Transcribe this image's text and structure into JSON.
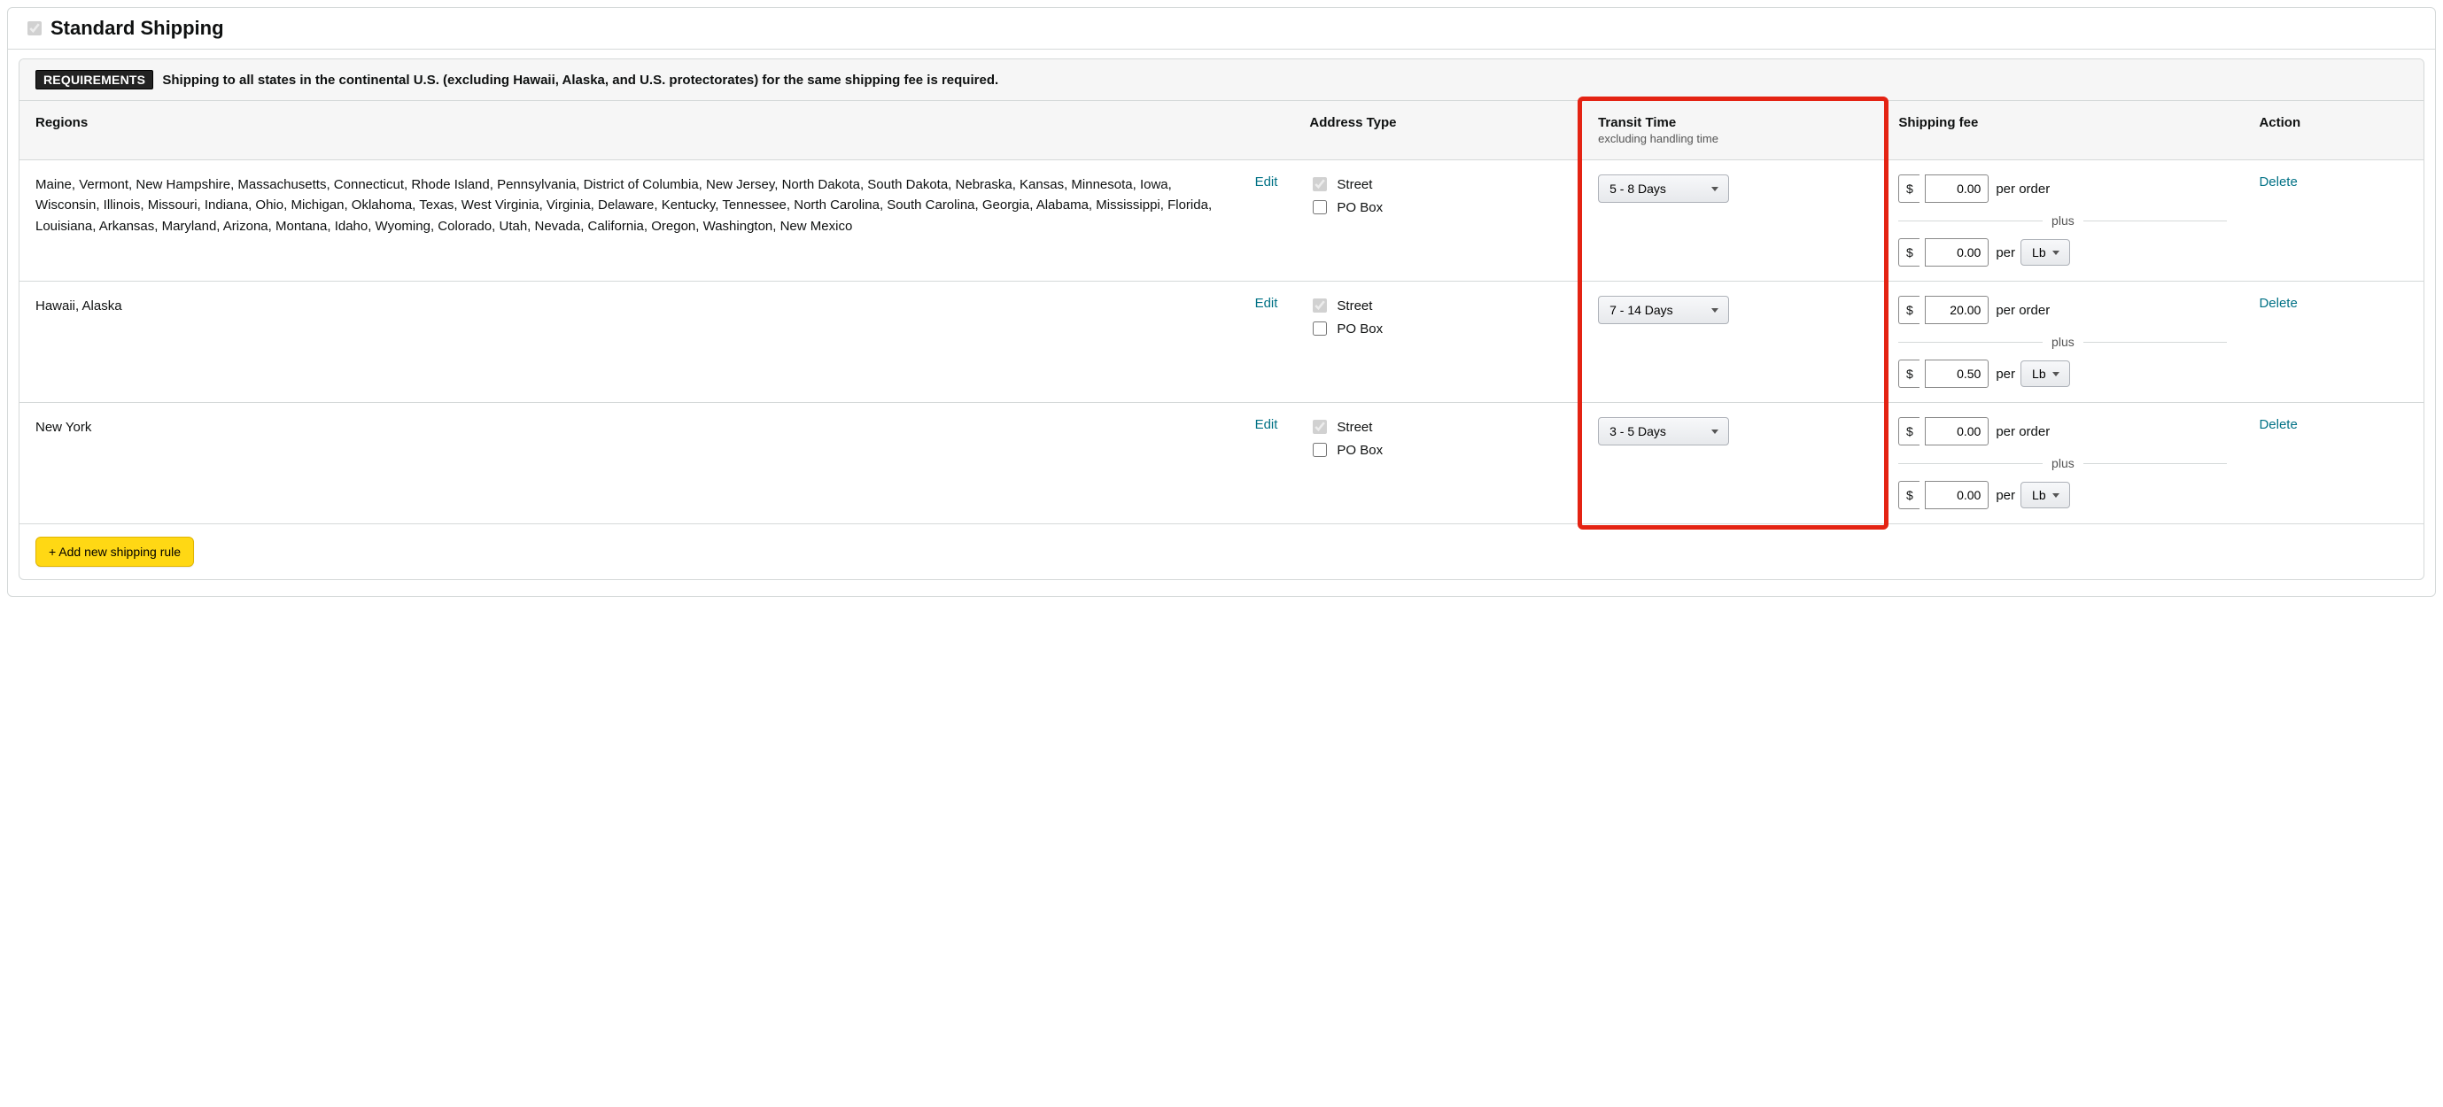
{
  "panel": {
    "title": "Standard Shipping",
    "top_checkbox_checked": true
  },
  "requirements": {
    "badge": "REQUIREMENTS",
    "text": "Shipping to all states in the continental U.S. (excluding Hawaii, Alaska, and U.S. protectorates) for the same shipping fee is required."
  },
  "columns": {
    "regions": "Regions",
    "address_type": "Address Type",
    "transit_time": "Transit Time",
    "transit_time_sub": "excluding handling time",
    "shipping_fee": "Shipping fee",
    "action": "Action"
  },
  "labels": {
    "edit": "Edit",
    "delete": "Delete",
    "street": "Street",
    "pobox": "PO Box",
    "per_order": "per order",
    "per": "per",
    "plus": "plus",
    "currency": "$",
    "add_rule": "+ Add new shipping rule"
  },
  "transit_options": [
    "3 - 5 Days",
    "5 - 8 Days",
    "7 - 14 Days"
  ],
  "unit_options": [
    "Lb"
  ],
  "rows": [
    {
      "regions": "Maine, Vermont, New Hampshire, Massachusetts, Connecticut, Rhode Island, Pennsylvania, District of Columbia, New Jersey, North Dakota, South Dakota, Nebraska, Kansas, Minnesota, Iowa, Wisconsin, Illinois, Missouri, Indiana, Ohio, Michigan, Oklahoma, Texas, West Virginia, Virginia, Delaware, Kentucky, Tennessee, North Carolina, South Carolina, Georgia, Alabama, Mississippi, Florida, Louisiana, Arkansas, Maryland, Arizona, Montana, Idaho, Wyoming, Colorado, Utah, Nevada, California, Oregon, Washington, New Mexico",
      "street": true,
      "pobox": false,
      "transit": "5 - 8 Days",
      "fee_order": "0.00",
      "fee_unit": "0.00",
      "unit": "Lb"
    },
    {
      "regions": "Hawaii, Alaska",
      "street": true,
      "pobox": false,
      "transit": "7 - 14 Days",
      "fee_order": "20.00",
      "fee_unit": "0.50",
      "unit": "Lb"
    },
    {
      "regions": "New York",
      "street": true,
      "pobox": false,
      "transit": "3 - 5 Days",
      "fee_order": "0.00",
      "fee_unit": "0.00",
      "unit": "Lb"
    }
  ],
  "highlight": {
    "column": "transit_time"
  }
}
